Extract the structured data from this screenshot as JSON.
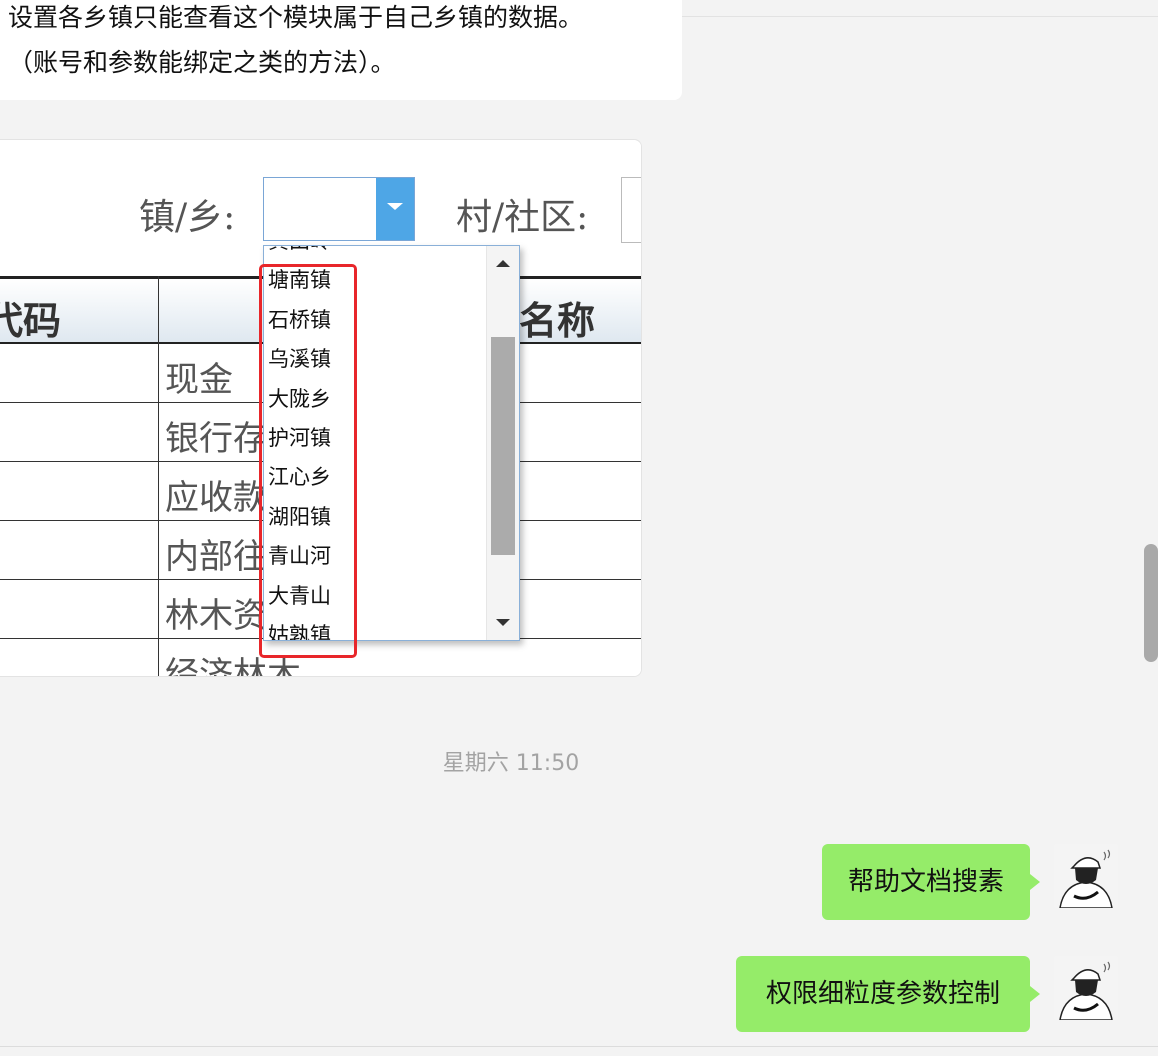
{
  "messages": {
    "incoming_line1": "设置各乡镇只能查看这个模块属于自己乡镇的数据。",
    "incoming_line2": "（账号和参数能绑定之类的方法）。",
    "timestamp": "星期六 11:50",
    "outgoing": [
      {
        "text": "帮助文档搜素"
      },
      {
        "text": "权限细粒度参数控制"
      }
    ]
  },
  "screenshot": {
    "town_label": "镇/乡:",
    "village_label": "村/社区:",
    "town_select_value": "",
    "table": {
      "col_code_header": "代码",
      "col_name_header": "名称",
      "rows": [
        "现金",
        "银行存款",
        "应收款",
        "内部往来",
        "林木资产",
        "经济林木"
      ]
    },
    "dropdown_options": [
      "黄田岭",
      "塘南镇",
      "石桥镇",
      "乌溪镇",
      "大陇乡",
      "护河镇",
      "江心乡",
      "湖阳镇",
      "青山河",
      "大青山",
      "姑孰镇"
    ]
  },
  "colors": {
    "outgoing_bubble": "#95ec69",
    "incoming_bubble": "#ffffff",
    "highlight": "#e8262a",
    "select_arrow": "#4ea6e6"
  }
}
